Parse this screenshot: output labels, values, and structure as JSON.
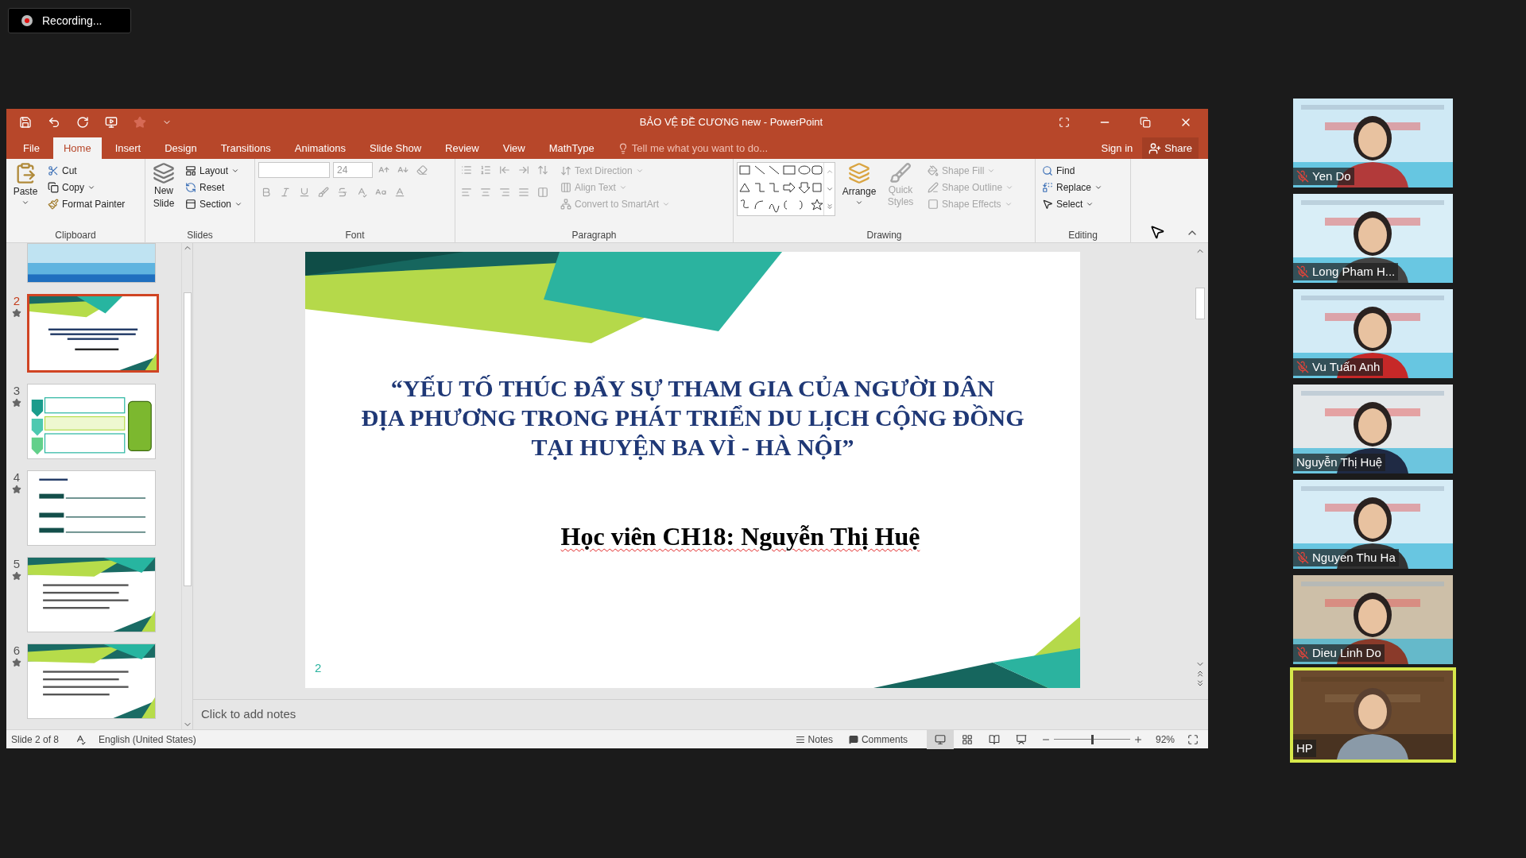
{
  "recording": {
    "label": "Recording..."
  },
  "window": {
    "title": "BẢO VỆ ĐỀ CƯƠNG new - PowerPoint"
  },
  "tabs": [
    {
      "label": "File",
      "selected": false
    },
    {
      "label": "Home",
      "selected": true
    },
    {
      "label": "Insert",
      "selected": false
    },
    {
      "label": "Design",
      "selected": false
    },
    {
      "label": "Transitions",
      "selected": false
    },
    {
      "label": "Animations",
      "selected": false
    },
    {
      "label": "Slide Show",
      "selected": false
    },
    {
      "label": "Review",
      "selected": false
    },
    {
      "label": "View",
      "selected": false
    },
    {
      "label": "MathType",
      "selected": false
    }
  ],
  "tell_me": {
    "placeholder": "Tell me what you want to do..."
  },
  "account": {
    "sign_in": "Sign in",
    "share": "Share"
  },
  "ribbon": {
    "clipboard": {
      "label": "Clipboard",
      "paste": "Paste",
      "items": [
        {
          "label": "Cut"
        },
        {
          "label": "Copy"
        },
        {
          "label": "Format Painter"
        }
      ]
    },
    "slides": {
      "label": "Slides",
      "new_slide": "New Slide",
      "items": [
        {
          "label": "Layout"
        },
        {
          "label": "Reset"
        },
        {
          "label": "Section"
        }
      ]
    },
    "font": {
      "label": "Font",
      "font_size": "24"
    },
    "paragraph": {
      "label": "Paragraph",
      "items": [
        {
          "label": "Text Direction",
          "disabled": true
        },
        {
          "label": "Align Text",
          "disabled": true
        },
        {
          "label": "Convert to SmartArt",
          "disabled": true
        }
      ]
    },
    "drawing": {
      "label": "Drawing",
      "arrange": "Arrange",
      "quick_styles": {
        "label": "Quick Styles",
        "disabled": true
      },
      "items": [
        {
          "label": "Shape Fill",
          "disabled": true
        },
        {
          "label": "Shape Outline",
          "disabled": true
        },
        {
          "label": "Shape Effects",
          "disabled": true
        }
      ]
    },
    "editing": {
      "label": "Editing",
      "items": [
        {
          "label": "Find"
        },
        {
          "label": "Replace"
        },
        {
          "label": "Select"
        }
      ]
    }
  },
  "thumbnails": [
    {
      "kind": "cover",
      "selected": false
    },
    {
      "kind": "title",
      "number": "2",
      "selected": true
    },
    {
      "kind": "chevrons",
      "number": "3",
      "selected": false
    },
    {
      "kind": "list",
      "number": "4",
      "selected": false
    },
    {
      "kind": "banner",
      "number": "5",
      "selected": false
    },
    {
      "kind": "banner",
      "number": "6",
      "selected": false
    }
  ],
  "slide": {
    "title": "“YẾU TỐ THÚC ĐẨY SỰ THAM GIA CỦA NGƯỜI DÂN\nĐỊA PHƯƠNG TRONG PHÁT TRIỂN DU LỊCH CỘNG ĐỒNG\nTẠI HUYỆN BA VÌ -  HÀ NỘI”",
    "subtitle": "Học viên CH18: Nguyễn Thị Huệ",
    "number": "2"
  },
  "notes": {
    "placeholder": "Click to add notes"
  },
  "status_bar": {
    "slide_info": "Slide 2 of 8",
    "language": "English (United States)",
    "notes": "Notes",
    "comments": "Comments",
    "views": [
      {
        "selected": true
      },
      {
        "selected": false
      },
      {
        "selected": false
      },
      {
        "selected": false
      }
    ],
    "zoom": {
      "level": 0.5,
      "reading": "92%"
    }
  },
  "participants": [
    {
      "name": "Yen Do",
      "muted": true,
      "speaking": false
    },
    {
      "name": "Long Pham H...",
      "muted": true,
      "speaking": false
    },
    {
      "name": "Vu Tuấn Anh",
      "muted": true,
      "speaking": false
    },
    {
      "name": "Nguyễn Thị Huệ",
      "muted": false,
      "speaking": false
    },
    {
      "name": "Nguyen Thu Ha",
      "muted": true,
      "speaking": false
    },
    {
      "name": "Dieu Linh Do",
      "muted": true,
      "speaking": false
    },
    {
      "name": "HP",
      "muted": false,
      "speaking": true
    }
  ]
}
